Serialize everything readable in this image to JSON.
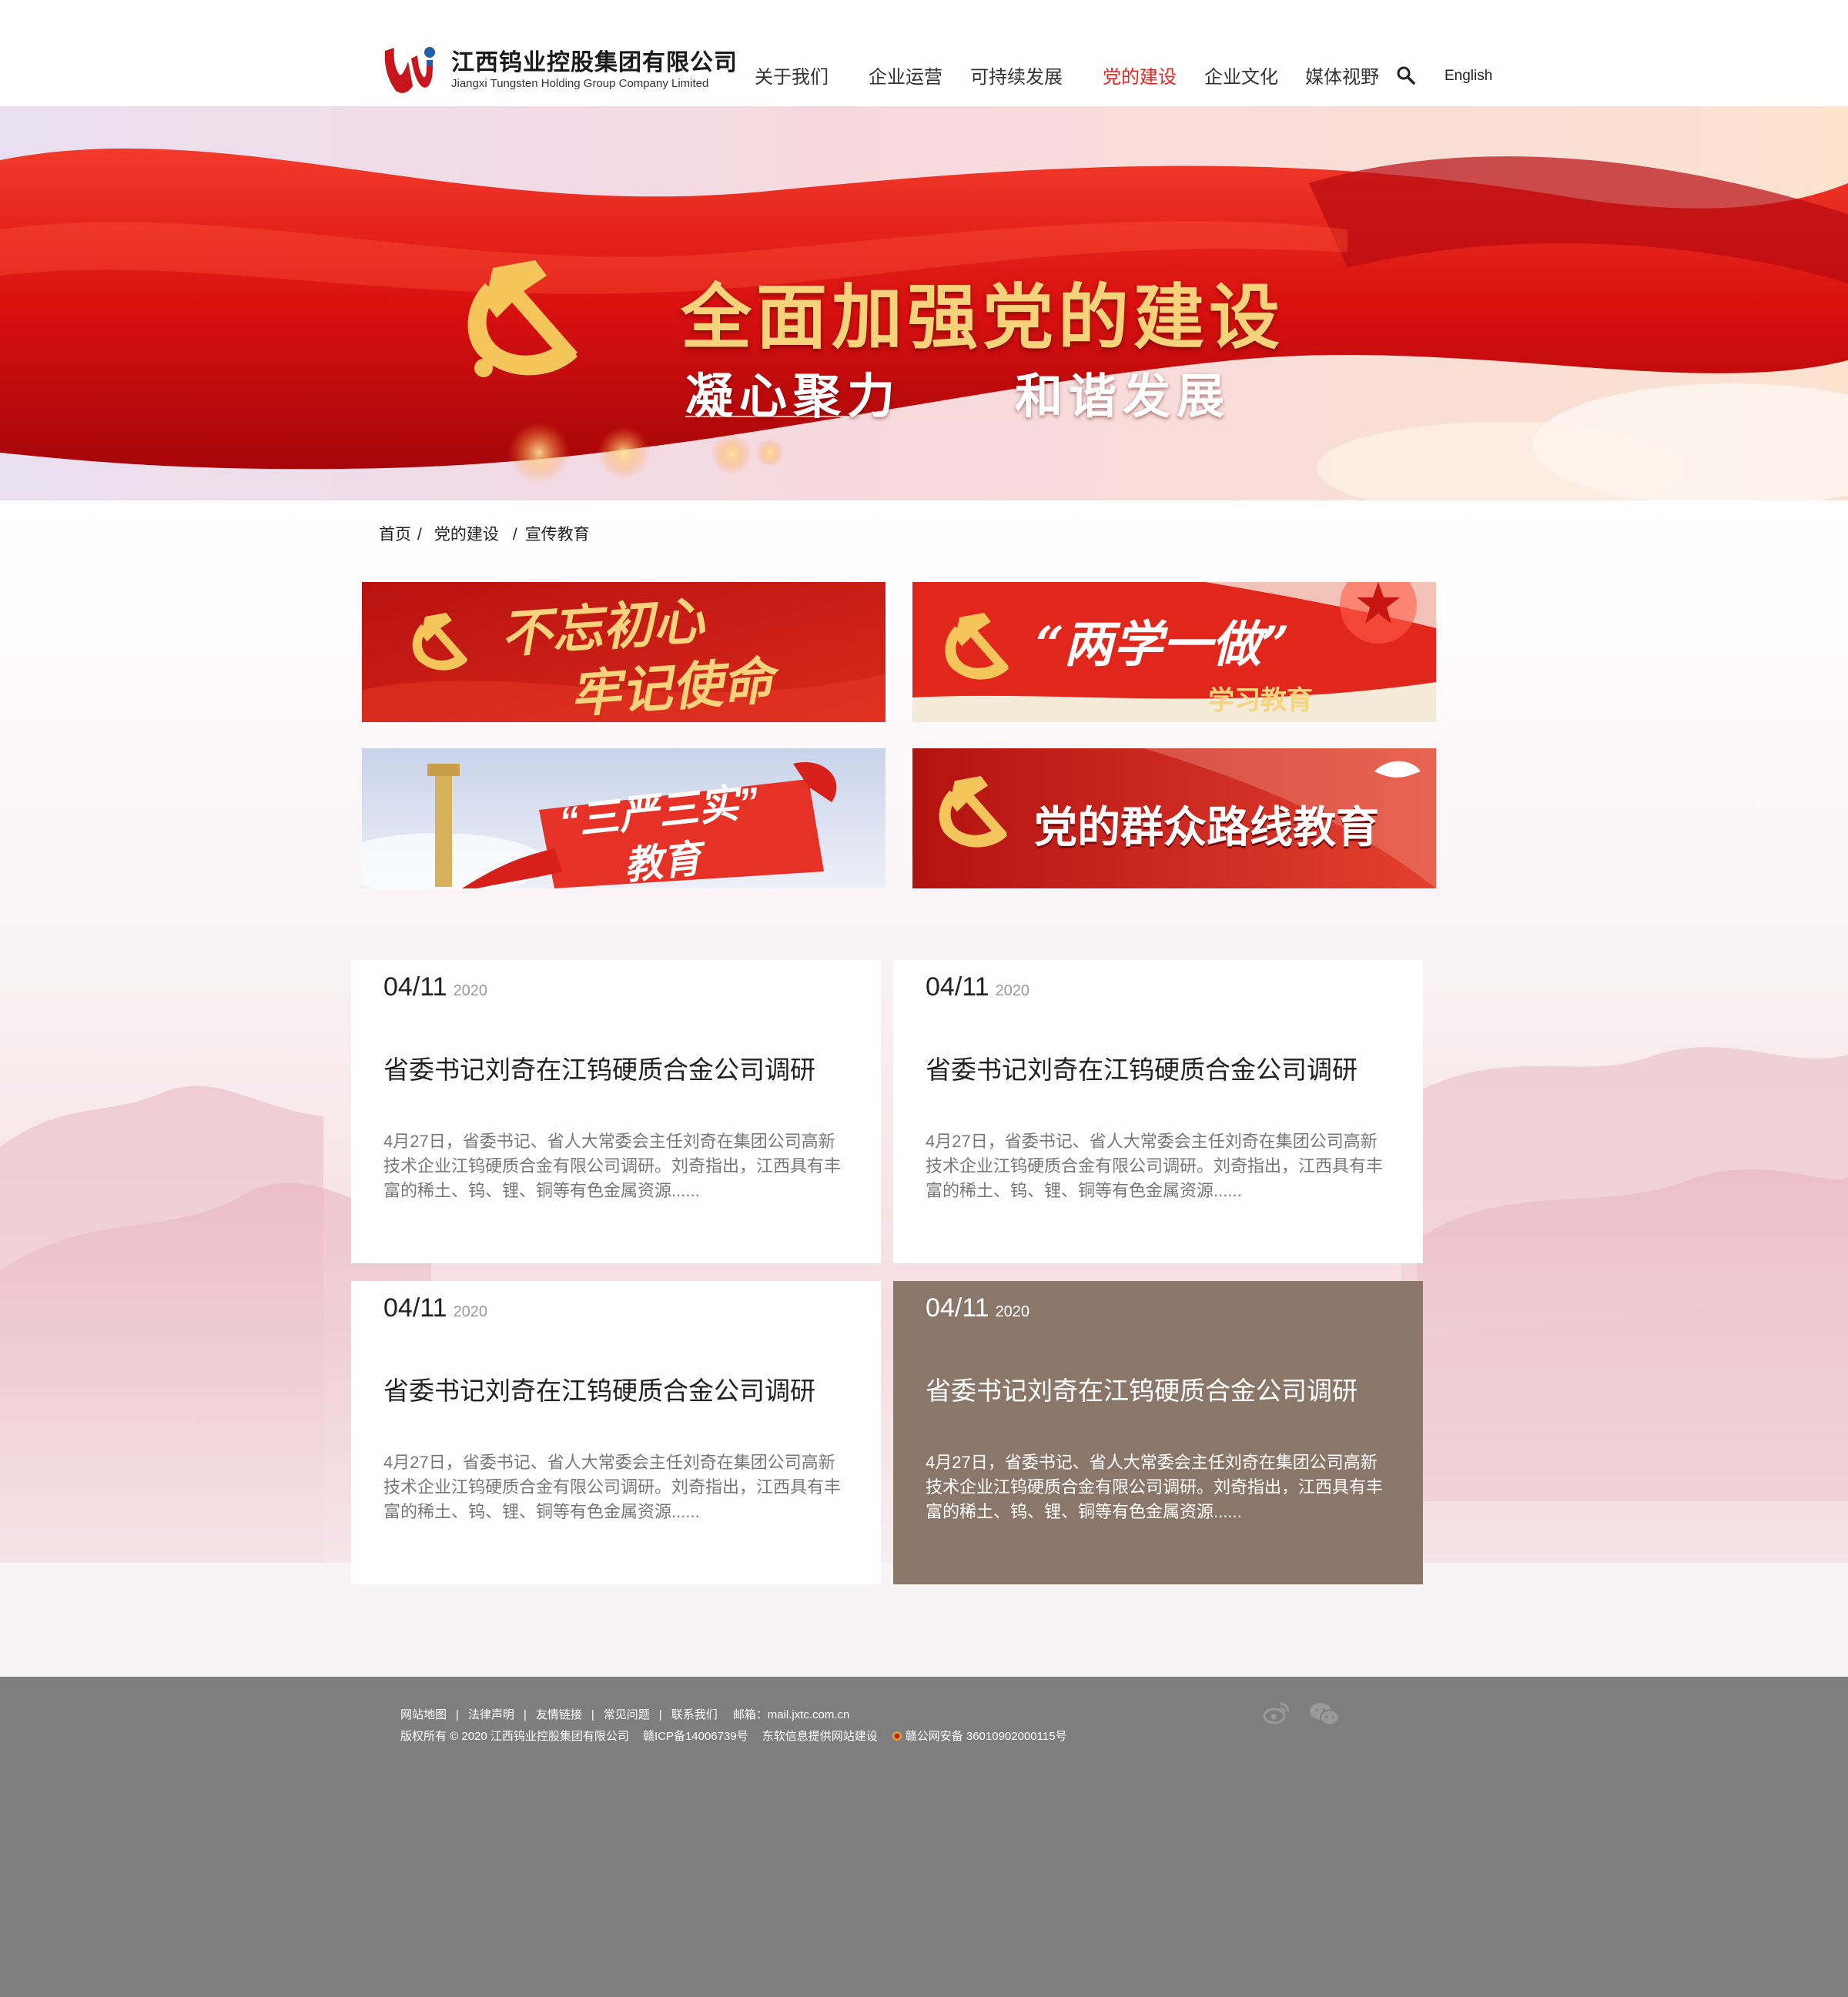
{
  "header": {
    "logo": {
      "name_cn": "江西钨业控股集团有限公司",
      "name_en": "Jiangxi Tungsten Holding Group Company Limited"
    },
    "nav": [
      {
        "label": "关于我们",
        "active": false
      },
      {
        "label": "企业运营",
        "active": false
      },
      {
        "label": "可持续发展",
        "active": false
      },
      {
        "label": "党的建设",
        "active": true
      },
      {
        "label": "企业文化",
        "active": false
      },
      {
        "label": "媒体视野",
        "active": false
      }
    ],
    "language": "English",
    "active_color": "#e02a24"
  },
  "banner": {
    "title": "全面加强党的建设",
    "subtitle_left": "凝心聚力",
    "subtitle_right": "和谐发展"
  },
  "breadcrumb": {
    "items": [
      "首页",
      "党的建设",
      "宣传教育"
    ],
    "separator": "/"
  },
  "topic_tiles": [
    {
      "lines": [
        "不忘初心",
        "牢记使命"
      ]
    },
    {
      "title": "“两学一做”",
      "subtitle": "学习教育"
    },
    {
      "title": "“三严三实”",
      "subtitle": "教育"
    },
    {
      "title": "党的群众路线教育"
    }
  ],
  "news": [
    {
      "date": "04/11",
      "year": "2020",
      "title": "省委书记刘奇在江钨硬质合金公司调研",
      "excerpt": "4月27日，省委书记、省人大常委会主任刘奇在集团公司高新技术企业江钨硬质合金有限公司调研。刘奇指出，江西具有丰富的稀土、钨、锂、铜等有色金属资源......",
      "highlighted": false
    },
    {
      "date": "04/11",
      "year": "2020",
      "title": "省委书记刘奇在江钨硬质合金公司调研",
      "excerpt": "4月27日，省委书记、省人大常委会主任刘奇在集团公司高新技术企业江钨硬质合金有限公司调研。刘奇指出，江西具有丰富的稀土、钨、锂、铜等有色金属资源......",
      "highlighted": false
    },
    {
      "date": "04/11",
      "year": "2020",
      "title": "省委书记刘奇在江钨硬质合金公司调研",
      "excerpt": "4月27日，省委书记、省人大常委会主任刘奇在集团公司高新技术企业江钨硬质合金有限公司调研。刘奇指出，江西具有丰富的稀土、钨、锂、铜等有色金属资源......",
      "highlighted": false
    },
    {
      "date": "04/11",
      "year": "2020",
      "title": "省委书记刘奇在江钨硬质合金公司调研",
      "excerpt": "4月27日，省委书记、省人大常委会主任刘奇在集团公司高新技术企业江钨硬质合金有限公司调研。刘奇指出，江西具有丰富的稀土、钨、锂、铜等有色金属资源......",
      "highlighted": true
    }
  ],
  "footer": {
    "links": [
      "网站地图",
      "法律声明",
      "友情链接",
      "常见问题",
      "联系我们"
    ],
    "email": "邮箱：mail.jxtc.com.cn",
    "copyright": "版权所有 © 2020 江西钨业控股集团有限公司",
    "icp": "赣ICP备14006739号",
    "builder": "东软信息提供网站建设",
    "police": "赣公网安备 36010902000115号",
    "background": "#7e7e7e"
  },
  "icons": [
    "search-icon",
    "weibo-icon",
    "wechat-icon",
    "police-badge-icon",
    "hammer-sickle-icon"
  ]
}
